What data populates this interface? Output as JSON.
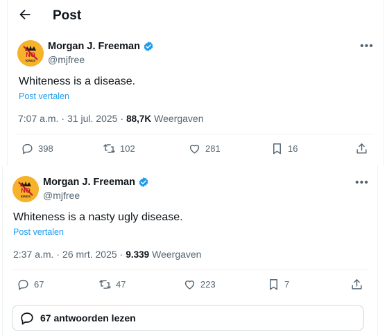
{
  "header": {
    "title": "Post"
  },
  "posts": [
    {
      "author": "Morgan J. Freeman",
      "handle": "@mjfree",
      "avatar_text": "NO KINGS",
      "text": "Whiteness is a disease.",
      "translate": "Post vertalen",
      "time": "7:07 a.m.",
      "dot": "·",
      "date": "31 jul. 2025",
      "views": "88,7K",
      "views_label": "Weergaven",
      "replies": "398",
      "reposts": "102",
      "likes": "281",
      "bookmarks": "16"
    },
    {
      "author": "Morgan J. Freeman",
      "handle": "@mjfree",
      "avatar_text": "NO KINGS",
      "text": "Whiteness is a nasty ugly disease.",
      "translate": "Post vertalen",
      "time": "2:37 a.m.",
      "dot": "·",
      "date": "26 mrt. 2025",
      "views": "9.339",
      "views_label": "Weergaven",
      "replies": "67",
      "reposts": "47",
      "likes": "223",
      "bookmarks": "7"
    }
  ],
  "read_replies": "67 antwoorden lezen",
  "colors": {
    "accent": "#1d9bf0",
    "verified": "#1d9bf0",
    "avatar_bg": "#f6b22a"
  },
  "icons": [
    "back-arrow-icon",
    "verified-badge-icon",
    "more-icon",
    "reply-icon",
    "repost-icon",
    "like-icon",
    "bookmark-icon",
    "share-icon",
    "speech-bubble-icon"
  ]
}
